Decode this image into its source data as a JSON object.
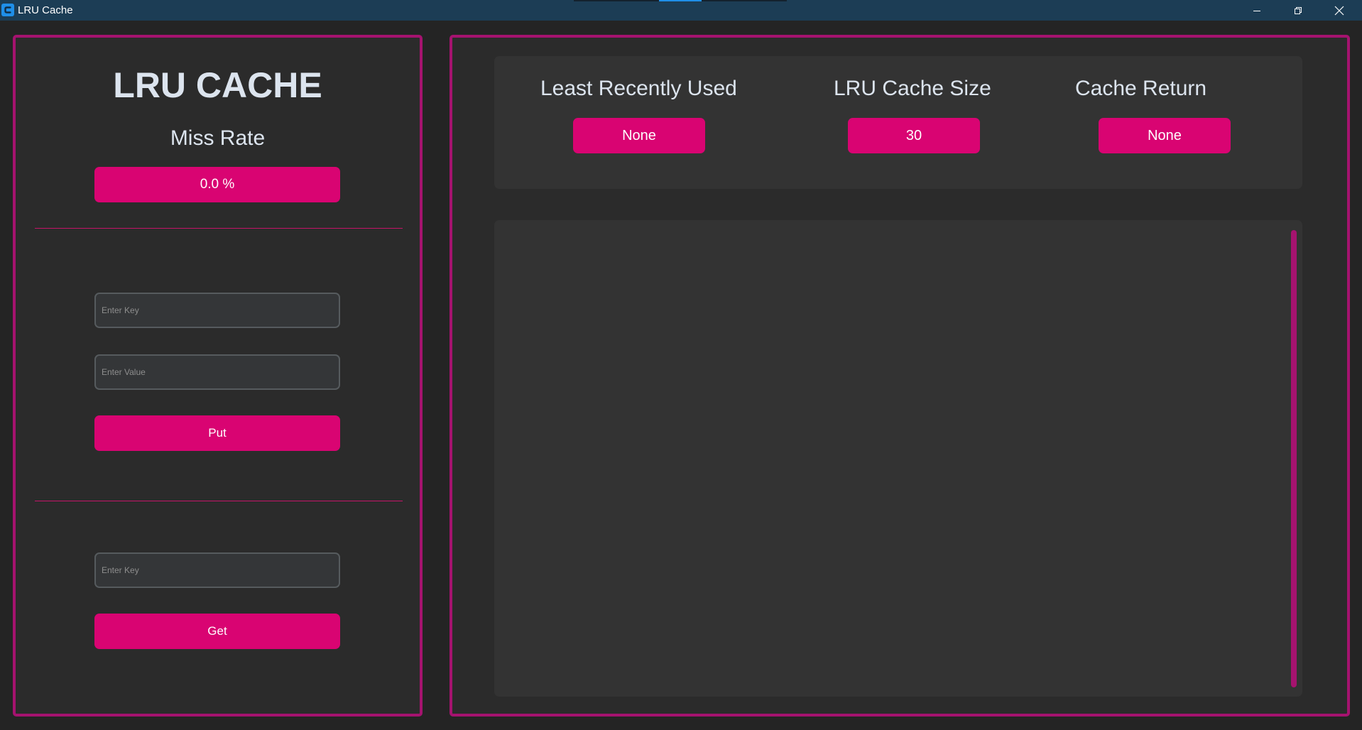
{
  "window": {
    "title": "LRU Cache",
    "titlebar_color": "#1c3d55",
    "controls": {
      "minimize_icon": "minimize-icon",
      "maximize_icon": "restore-icon",
      "close_icon": "close-icon"
    }
  },
  "theme": {
    "accent": "#d90472",
    "border": "#a5136f",
    "background": "#242424",
    "panel": "#2b2b2b",
    "frame": "#333333",
    "text": "#dce4ee"
  },
  "left": {
    "heading": "LRU CACHE",
    "miss_rate_label": "Miss Rate",
    "miss_rate_value": "0.0 %",
    "put_key_placeholder": "Enter Key",
    "put_value_placeholder": "Enter Value",
    "put_button": "Put",
    "get_key_placeholder": "Enter Key",
    "get_button": "Get"
  },
  "right": {
    "lru_label": "Least Recently Used",
    "lru_value": "None",
    "size_label": "LRU Cache Size",
    "size_value": "30",
    "return_label": "Cache Return",
    "return_value": "None"
  }
}
